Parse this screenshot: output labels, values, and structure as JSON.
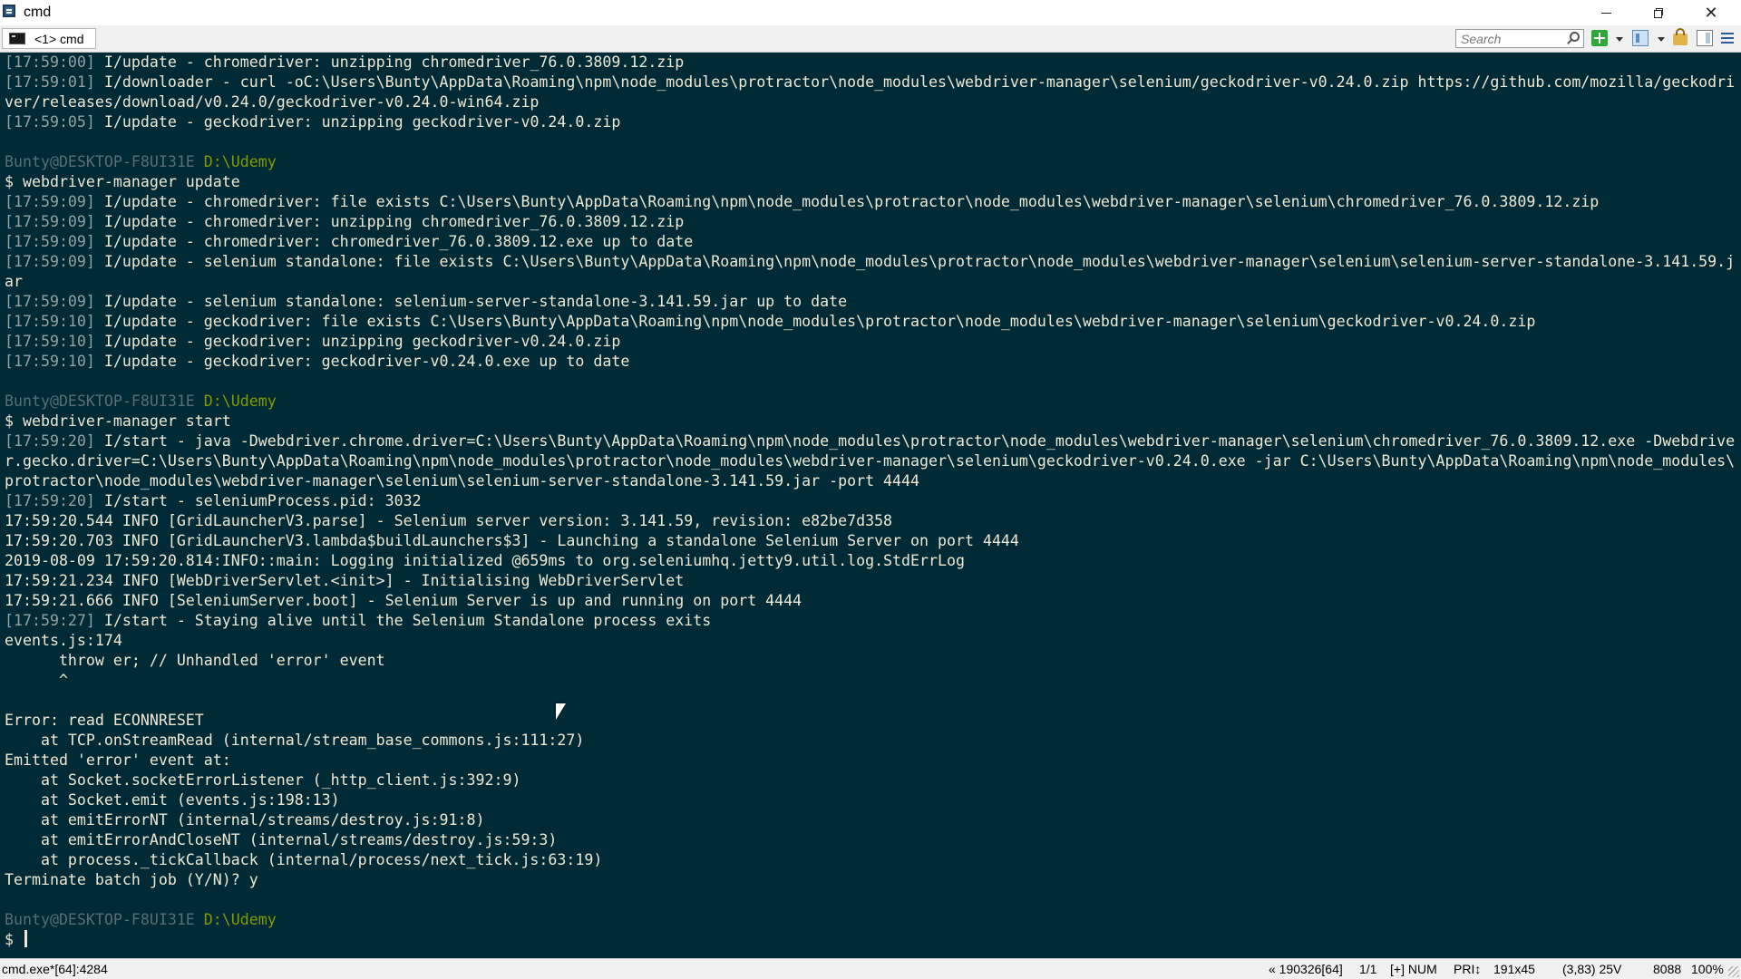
{
  "window": {
    "title": "cmd",
    "icon": "console-app-icon",
    "controls": [
      "minimize-icon",
      "restore-icon",
      "close-icon"
    ]
  },
  "tabbar": {
    "tab_label": "<1> cmd",
    "search_placeholder": "Search",
    "icons": [
      "new-console-icon",
      "dropdown-icon",
      "split-panes-icon",
      "dropdown-icon",
      "lock-icon",
      "view-icon",
      "menu-icon"
    ]
  },
  "console": {
    "lines": [
      "[17:59:00] I/update - chromedriver: unzipping chromedriver_76.0.3809.12.zip",
      "[17:59:01] I/downloader - curl -oC:\\Users\\Bunty\\AppData\\Roaming\\npm\\node_modules\\protractor\\node_modules\\webdriver-manager\\selenium/geckodriver-v0.24.0.zip https://github.com/mozilla/geckodri",
      "ver/releases/download/v0.24.0/geckodriver-v0.24.0-win64.zip",
      "[17:59:05] I/update - geckodriver: unzipping geckodriver-v0.24.0.zip",
      "",
      "Bunty@DESKTOP-F8UI31E D:\\Udemy",
      "$ webdriver-manager update",
      "[17:59:09] I/update - chromedriver: file exists C:\\Users\\Bunty\\AppData\\Roaming\\npm\\node_modules\\protractor\\node_modules\\webdriver-manager\\selenium\\chromedriver_76.0.3809.12.zip",
      "[17:59:09] I/update - chromedriver: unzipping chromedriver_76.0.3809.12.zip",
      "[17:59:09] I/update - chromedriver: chromedriver_76.0.3809.12.exe up to date",
      "[17:59:09] I/update - selenium standalone: file exists C:\\Users\\Bunty\\AppData\\Roaming\\npm\\node_modules\\protractor\\node_modules\\webdriver-manager\\selenium\\selenium-server-standalone-3.141.59.j",
      "ar",
      "[17:59:09] I/update - selenium standalone: selenium-server-standalone-3.141.59.jar up to date",
      "[17:59:10] I/update - geckodriver: file exists C:\\Users\\Bunty\\AppData\\Roaming\\npm\\node_modules\\protractor\\node_modules\\webdriver-manager\\selenium\\geckodriver-v0.24.0.zip",
      "[17:59:10] I/update - geckodriver: unzipping geckodriver-v0.24.0.zip",
      "[17:59:10] I/update - geckodriver: geckodriver-v0.24.0.exe up to date",
      "",
      "Bunty@DESKTOP-F8UI31E D:\\Udemy",
      "$ webdriver-manager start",
      "[17:59:20] I/start - java -Dwebdriver.chrome.driver=C:\\Users\\Bunty\\AppData\\Roaming\\npm\\node_modules\\protractor\\node_modules\\webdriver-manager\\selenium\\chromedriver_76.0.3809.12.exe -Dwebdrive",
      "r.gecko.driver=C:\\Users\\Bunty\\AppData\\Roaming\\npm\\node_modules\\protractor\\node_modules\\webdriver-manager\\selenium\\geckodriver-v0.24.0.exe -jar C:\\Users\\Bunty\\AppData\\Roaming\\npm\\node_modules\\",
      "protractor\\node_modules\\webdriver-manager\\selenium\\selenium-server-standalone-3.141.59.jar -port 4444",
      "[17:59:20] I/start - seleniumProcess.pid: 3032",
      "17:59:20.544 INFO [GridLauncherV3.parse] - Selenium server version: 3.141.59, revision: e82be7d358",
      "17:59:20.703 INFO [GridLauncherV3.lambda$buildLaunchers$3] - Launching a standalone Selenium Server on port 4444",
      "2019-08-09 17:59:20.814:INFO::main: Logging initialized @659ms to org.seleniumhq.jetty9.util.log.StdErrLog",
      "17:59:21.234 INFO [WebDriverServlet.<init>] - Initialising WebDriverServlet",
      "17:59:21.666 INFO [SeleniumServer.boot] - Selenium Server is up and running on port 4444",
      "[17:59:27] I/start - Staying alive until the Selenium Standalone process exits",
      "events.js:174",
      "      throw er; // Unhandled 'error' event",
      "      ^",
      "",
      "Error: read ECONNRESET",
      "    at TCP.onStreamRead (internal/stream_base_commons.js:111:27)",
      "Emitted 'error' event at:",
      "    at Socket.socketErrorListener (_http_client.js:392:9)",
      "    at Socket.emit (events.js:198:13)",
      "    at emitErrorNT (internal/streams/destroy.js:91:8)",
      "    at emitErrorAndCloseNT (internal/streams/destroy.js:59:3)",
      "    at process._tickCallback (internal/process/next_tick.js:63:19)",
      "Terminate batch job (Y/N)? y",
      "",
      "Bunty@DESKTOP-F8UI31E D:\\Udemy",
      "$ "
    ]
  },
  "statusbar": {
    "process": "cmd.exe*[64]:4284",
    "position": "« 190326[64]",
    "pages": "1/1",
    "keys": "[+] NUM",
    "priority": "PRI↕",
    "size": "191x45",
    "cursor": "(3,83) 25V",
    "pid": "8088",
    "zoom": "100%"
  },
  "colors": {
    "background": "#002b36",
    "foreground": "#eee8d5",
    "timestamp": "#93a1a1",
    "prompt_user": "#586e75",
    "prompt_path": "#859900"
  }
}
